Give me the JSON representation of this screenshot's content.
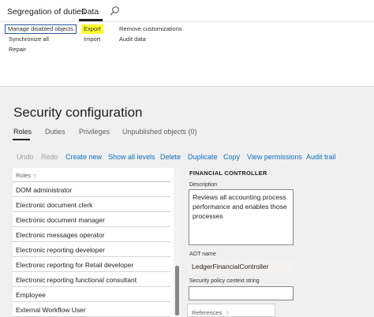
{
  "ribbon": {
    "tabs": {
      "title": "Segregation of duties",
      "data": "Data"
    },
    "items": {
      "manage_disabled": "Manage disabled objects",
      "synchronize": "Synchronize all",
      "repair": "Repair",
      "export": "Export",
      "import": "Import",
      "remove_customizations": "Remove customizations",
      "audit_data": "Audit data"
    },
    "search_icon": "search-icon",
    "export_highlight_color": "#ffff2e"
  },
  "page": {
    "title": "Security configuration",
    "tabs": [
      "Roles",
      "Duties",
      "Privileges",
      "Unpublished objects (0)"
    ]
  },
  "toolbar": {
    "undo": "Undo",
    "redo": "Redo",
    "create_new": "Create new",
    "show_all_levels": "Show all levels",
    "delete": "Delete",
    "duplicate": "Duplicate",
    "copy": "Copy",
    "view_permissions": "View permissions",
    "audit_trail": "Audit trail"
  },
  "grid": {
    "header": "Roles",
    "sort_indicator": "↑",
    "rows": [
      "DOM administrator",
      "Electronic document clerk",
      "Electronic document manager",
      "Electronic messages operator",
      "Electronic reporting developer",
      "Electronic reporting for Retail developer",
      "Electronic reporting functional consultant",
      "Employee",
      "External Workflow User"
    ]
  },
  "details": {
    "section_title": "FINANCIAL CONTROLLER",
    "description_label": "Description",
    "description_value": "Reviews all accounting process performance and enables those processes",
    "aot_label": "AOT name",
    "aot_value": "LedgerFinancialController",
    "policy_label": "Security policy context string",
    "policy_value": "",
    "references_label": "References",
    "references_sort": "↑"
  },
  "colors": {
    "link": "#106ebe",
    "disabled": "#a19f9d",
    "ribbon_bg": "#ffffff",
    "page_bg": "#f0f0f0"
  }
}
